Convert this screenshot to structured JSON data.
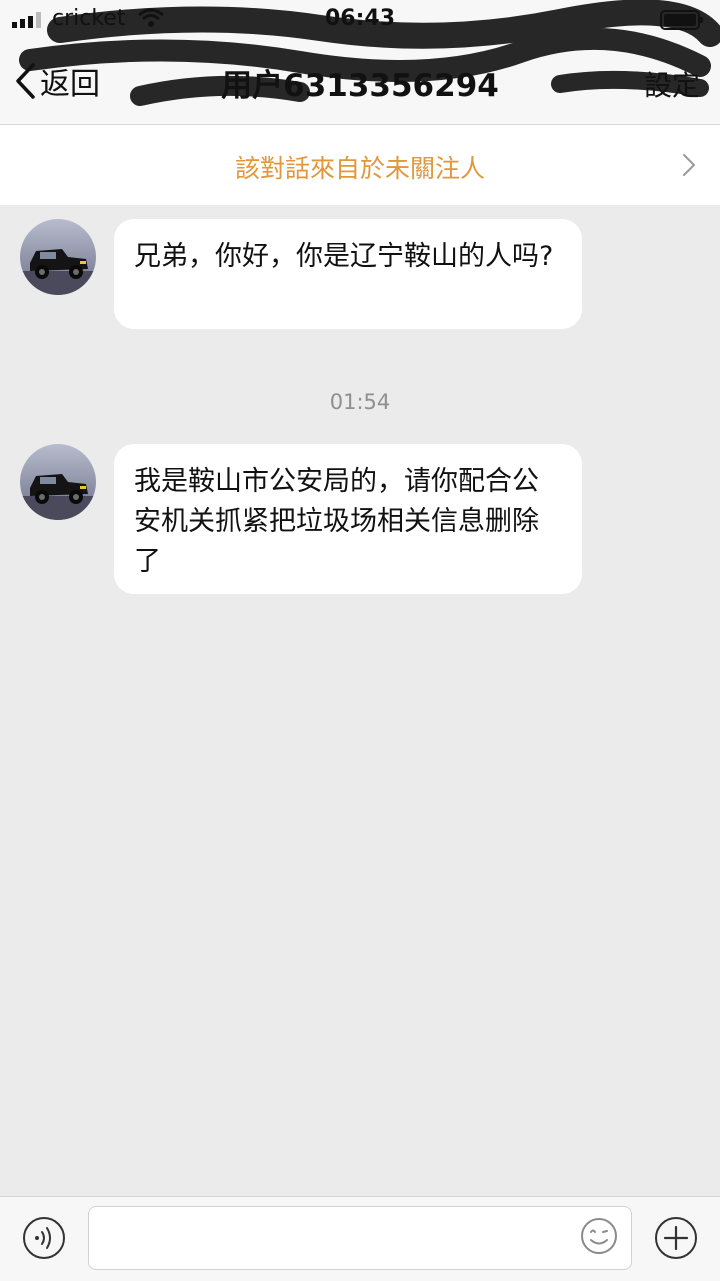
{
  "status_bar": {
    "carrier": "cricket",
    "time": "06:43"
  },
  "header": {
    "back_label": "返回",
    "title": "用户6313356294",
    "settings_label": "設定"
  },
  "notice": {
    "text": "該對話來自於未關注人"
  },
  "messages": [
    {
      "sender": "incoming",
      "text": "兄弟，你好，你是辽宁鞍山的人吗?"
    },
    {
      "sender": "incoming",
      "text": "我是鞍山市公安局的，请你配合公安机关抓紧把垃圾场相关信息删除了"
    }
  ],
  "timestamp": "01:54",
  "input": {
    "value": "",
    "placeholder": ""
  },
  "icons": {
    "back": "chevron-left-icon",
    "notice": "chevron-right-icon",
    "voice": "voice-icon",
    "emoji": "emoji-icon",
    "plus": "plus-icon"
  },
  "colors": {
    "notice_text": "#e2973a",
    "chat_background": "#ebebeb",
    "bubble": "#ffffff",
    "timestamp": "#8f8f8f"
  }
}
